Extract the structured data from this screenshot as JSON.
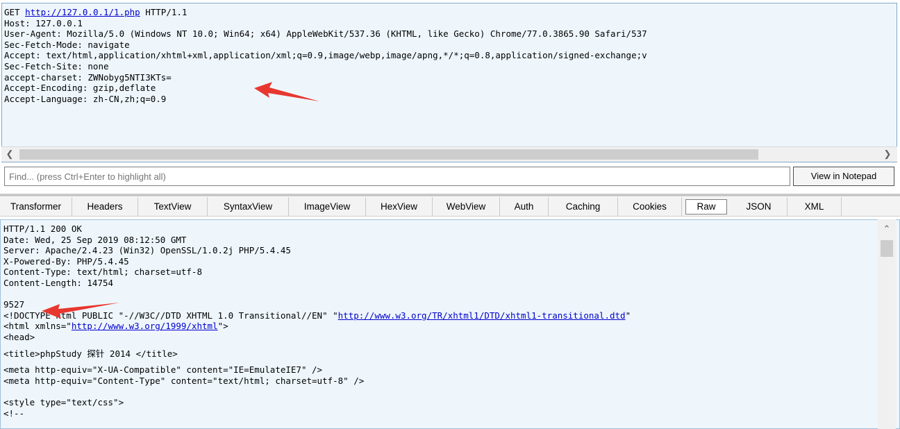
{
  "request": {
    "method": "GET",
    "url": "http://127.0.0.1/1.php",
    "protocol": "HTTP/1.1",
    "lines": [
      "Host: 127.0.0.1",
      "User-Agent: Mozilla/5.0 (Windows NT 10.0; Win64; x64) AppleWebKit/537.36 (KHTML, like Gecko) Chrome/77.0.3865.90 Safari/537",
      "Sec-Fetch-Mode: navigate",
      "Accept: text/html,application/xhtml+xml,application/xml;q=0.9,image/webp,image/apng,*/*;q=0.8,application/signed-exchange;v",
      "Sec-Fetch-Site: none",
      "accept-charset: ZWNobyg5NTI3KTs=",
      "Accept-Encoding: gzip,deflate",
      "Accept-Language: zh-CN,zh;q=0.9"
    ]
  },
  "find": {
    "placeholder": "Find... (press Ctrl+Enter to highlight all)",
    "notepad_label": "View in Notepad"
  },
  "tabs": [
    {
      "label": "Transformer"
    },
    {
      "label": "Headers"
    },
    {
      "label": "TextView"
    },
    {
      "label": "SyntaxView"
    },
    {
      "label": "ImageView"
    },
    {
      "label": "HexView"
    },
    {
      "label": "WebView"
    },
    {
      "label": "Auth"
    },
    {
      "label": "Caching"
    },
    {
      "label": "Cookies"
    },
    {
      "label": "Raw"
    },
    {
      "label": "JSON"
    },
    {
      "label": "XML"
    }
  ],
  "active_tab": "Raw",
  "response": {
    "status": "HTTP/1.1 200 OK",
    "headers": [
      "Date: Wed, 25 Sep 2019 08:12:50 GMT",
      "Server: Apache/2.4.23 (Win32) OpenSSL/1.0.2j PHP/5.4.45",
      "X-Powered-By: PHP/5.4.45",
      "Content-Type: text/html; charset=utf-8",
      "Content-Length: 14754"
    ],
    "body_first": "9527",
    "doctype_prefix": "<!DOCTYPE html PUBLIC \"-//W3C//DTD XHTML 1.0 Transitional//EN\" \"",
    "doctype_link": "http://www.w3.org/TR/xhtml1/DTD/xhtml1-transitional.dtd",
    "doctype_suffix": "\"",
    "html_prefix": "<html xmlns=\"",
    "html_link": "http://www.w3.org/1999/xhtml",
    "html_suffix": "\">",
    "head": "<head>",
    "title_line": "<title>phpStudy 探针 2014 </title>",
    "meta1": "<meta http-equiv=\"X-UA-Compatible\" content=\"IE=EmulateIE7\" />",
    "meta2": "<meta http-equiv=\"Content-Type\" content=\"text/html; charset=utf-8\" />",
    "style_open": "<style type=\"text/css\">",
    "comment_open": "<!--"
  },
  "colors": {
    "pane_bg": "#eef6fc",
    "link": "#0000cc",
    "annotation": "#e8372f"
  }
}
